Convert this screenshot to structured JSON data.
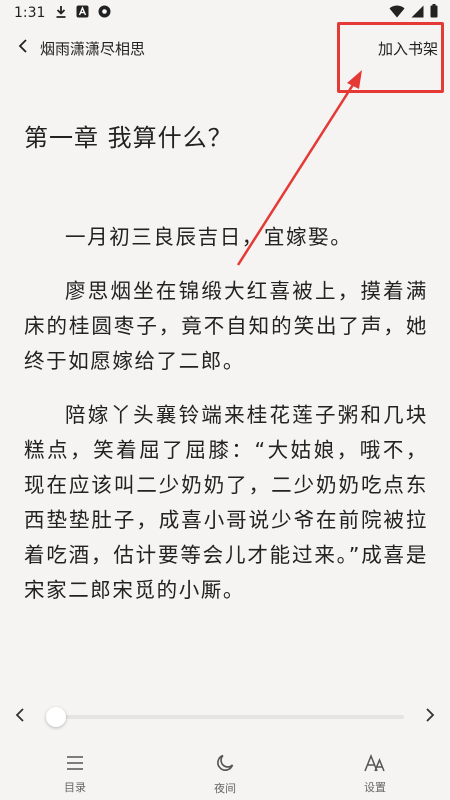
{
  "status_bar": {
    "time": "1:31",
    "icons": [
      "download-icon",
      "a-badge-icon",
      "record-icon",
      "wifi-icon",
      "signal-icon",
      "battery-icon"
    ]
  },
  "top_nav": {
    "back_icon": "chevron-left-icon",
    "book_title": "烟雨潇潇尽相思",
    "add_to_shelf": "加入书架"
  },
  "reader": {
    "chapter_title": "第一章 我算什么？",
    "paragraphs": [
      "一月初三良辰吉日，宜嫁娶。",
      "廖思烟坐在锦缎大红喜被上，摸着满床的桂圆枣子，竟不自知的笑出了声，她终于如愿嫁给了二郎。",
      "陪嫁丫头襄铃端来桂花莲子粥和几块糕点，笑着屈了屈膝：“大姑娘，哦不，现在应该叫二少奶奶了，二少奶奶吃点东西垫垫肚子，成喜小哥说少爷在前院被拉着吃酒，估计要等会儿才能过来。”成喜是宋家二郎宋觅的小厮。"
    ]
  },
  "progress": {
    "percent": 0
  },
  "bottom_bar": {
    "catalog": "目录",
    "night": "夜间",
    "settings": "设置"
  },
  "colors": {
    "background": "#f5f4f2",
    "annotation": "#e53935"
  }
}
